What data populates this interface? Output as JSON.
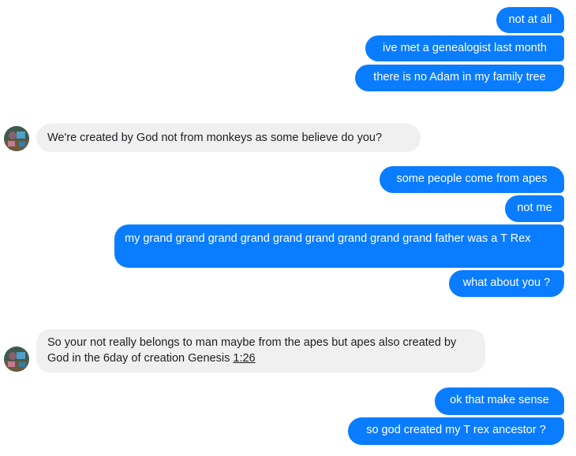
{
  "messages": [
    {
      "text": "not at all"
    },
    {
      "text": "ive met a genealogist last month"
    },
    {
      "text": "there is no Adam in my family tree"
    },
    {
      "text": "We're created by God not from monkeys as some believe do you?"
    },
    {
      "text": "some people come from apes"
    },
    {
      "text": "not me"
    },
    {
      "text": "my grand grand grand grand grand grand grand grand grand father was a T Rex"
    },
    {
      "text": "what about you ?"
    },
    {
      "text": "So your not really belongs to man maybe from the apes but apes also created by God in the 6day of creation Genesis ",
      "link": "1:26"
    },
    {
      "text": "ok that make sense"
    },
    {
      "text": "so god created my T rex ancestor ?"
    }
  ],
  "colors": {
    "outgoing_bubble": "#0a7cff",
    "incoming_bubble": "#f0f0f0"
  }
}
